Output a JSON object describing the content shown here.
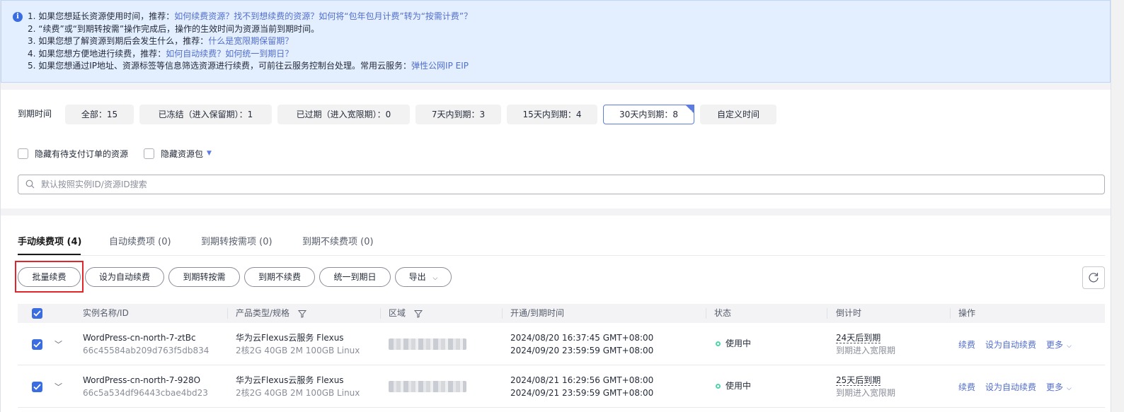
{
  "notice": {
    "lines": [
      {
        "text": "1. 如果您想延长资源使用时间，推荐：",
        "link": "如何续费资源？找不到想续费的资源？如何将“包年包月计费”转为“按需计费”？"
      },
      {
        "text": "2. “续费”或“到期转按需”操作完成后，操作的生效时间为资源当前到期时间。",
        "link": ""
      },
      {
        "text": "3. 如果您想了解资源到期后会发生什么，推荐：",
        "link": "什么是宽限期保留期？"
      },
      {
        "text": "4. 如果您想方便地进行续费，推荐：",
        "link": "如何自动续费？如何统一到期日？"
      },
      {
        "text": "5. 如果您想通过IP地址、资源标签等信息筛选资源进行续费，可前往云服务控制台处理。常用云服务：",
        "link": "弹性公网IP EIP"
      }
    ]
  },
  "filters": {
    "label": "到期时间",
    "chips": [
      "全部：15",
      "已冻结（进入保留期）：1",
      "已过期（进入宽限期）：0",
      "7天内到期：3",
      "15天内到期：4",
      "30天内到期：8",
      "自定义时间"
    ],
    "selected_index": 5,
    "hide_pending_label": "隐藏有待支付订单的资源",
    "hide_package_label": "隐藏资源包",
    "search_placeholder": "默认按照实例ID/资源ID搜索"
  },
  "tabs": [
    "手动续费项 (4)",
    "自动续费项 (0)",
    "到期转按需项 (0)",
    "到期不续费项 (0)"
  ],
  "actions": {
    "batch_renew": "批量续费",
    "set_auto": "设为自动续费",
    "to_on_demand": "到期转按需",
    "no_renew": "到期不续费",
    "unify": "统一到期日",
    "export": "导出"
  },
  "table": {
    "headers": [
      "实例名称/ID",
      "产品类型/规格",
      "区域",
      "开通/到期时间",
      "状态",
      "倒计时",
      "操作"
    ],
    "rows": [
      {
        "name": "WordPress-cn-north-7-ztBc",
        "id": "66c45584ab209d763f5db834",
        "product": "华为云Flexus云服务 Flexus",
        "spec": "2核2G 40GB 2M 100GB Linux",
        "open_time": "2024/08/20 16:37:45 GMT+08:00",
        "expire_time": "2024/09/20 23:59:59 GMT+08:00",
        "status": "使用中",
        "countdown": "24天后到期",
        "countdown_sub": "到期进入宽限期",
        "op_renew": "续费",
        "op_auto": "设为自动续费",
        "op_more": "更多"
      },
      {
        "name": "WordPress-cn-north-7-928O",
        "id": "66c5a534df96443cbae4bd23",
        "product": "华为云Flexus云服务 Flexus",
        "spec": "2核2G 40GB 2M 100GB Linux",
        "open_time": "2024/08/21 16:29:56 GMT+08:00",
        "expire_time": "2024/09/21 23:59:59 GMT+08:00",
        "status": "使用中",
        "countdown": "25天后到期",
        "countdown_sub": "到期进入宽限期",
        "op_renew": "续费",
        "op_auto": "设为自动续费",
        "op_more": "更多"
      }
    ]
  },
  "colors": {
    "brand": "#5e7ce0",
    "link": "#526ecc",
    "highlight": "#e0262a",
    "status_ok": "#50d4ab",
    "notice_bg": "#e3efff"
  }
}
